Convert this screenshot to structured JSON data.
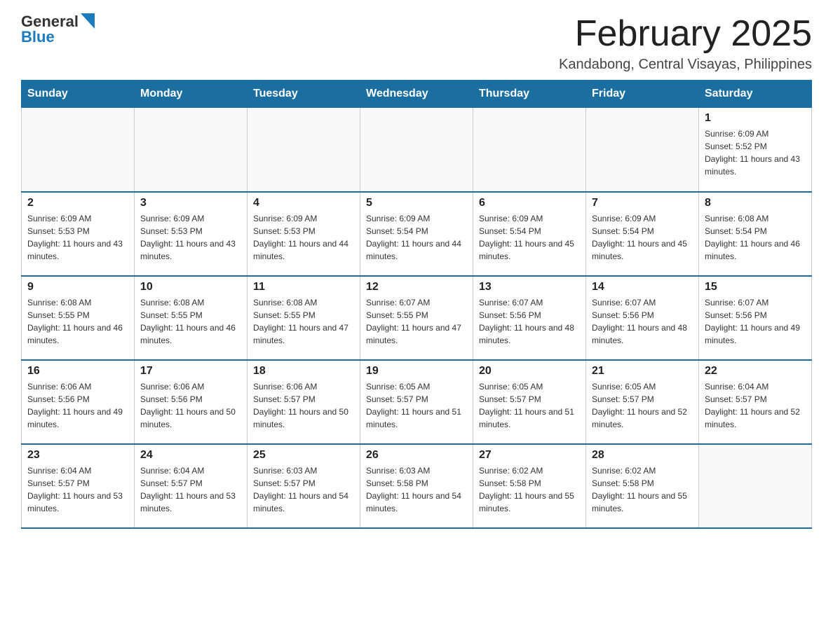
{
  "logo": {
    "text_general": "General",
    "text_blue": "Blue"
  },
  "title": "February 2025",
  "subtitle": "Kandabong, Central Visayas, Philippines",
  "weekdays": [
    "Sunday",
    "Monday",
    "Tuesday",
    "Wednesday",
    "Thursday",
    "Friday",
    "Saturday"
  ],
  "weeks": [
    [
      {
        "day": "",
        "sunrise": "",
        "sunset": "",
        "daylight": ""
      },
      {
        "day": "",
        "sunrise": "",
        "sunset": "",
        "daylight": ""
      },
      {
        "day": "",
        "sunrise": "",
        "sunset": "",
        "daylight": ""
      },
      {
        "day": "",
        "sunrise": "",
        "sunset": "",
        "daylight": ""
      },
      {
        "day": "",
        "sunrise": "",
        "sunset": "",
        "daylight": ""
      },
      {
        "day": "",
        "sunrise": "",
        "sunset": "",
        "daylight": ""
      },
      {
        "day": "1",
        "sunrise": "Sunrise: 6:09 AM",
        "sunset": "Sunset: 5:52 PM",
        "daylight": "Daylight: 11 hours and 43 minutes."
      }
    ],
    [
      {
        "day": "2",
        "sunrise": "Sunrise: 6:09 AM",
        "sunset": "Sunset: 5:53 PM",
        "daylight": "Daylight: 11 hours and 43 minutes."
      },
      {
        "day": "3",
        "sunrise": "Sunrise: 6:09 AM",
        "sunset": "Sunset: 5:53 PM",
        "daylight": "Daylight: 11 hours and 43 minutes."
      },
      {
        "day": "4",
        "sunrise": "Sunrise: 6:09 AM",
        "sunset": "Sunset: 5:53 PM",
        "daylight": "Daylight: 11 hours and 44 minutes."
      },
      {
        "day": "5",
        "sunrise": "Sunrise: 6:09 AM",
        "sunset": "Sunset: 5:54 PM",
        "daylight": "Daylight: 11 hours and 44 minutes."
      },
      {
        "day": "6",
        "sunrise": "Sunrise: 6:09 AM",
        "sunset": "Sunset: 5:54 PM",
        "daylight": "Daylight: 11 hours and 45 minutes."
      },
      {
        "day": "7",
        "sunrise": "Sunrise: 6:09 AM",
        "sunset": "Sunset: 5:54 PM",
        "daylight": "Daylight: 11 hours and 45 minutes."
      },
      {
        "day": "8",
        "sunrise": "Sunrise: 6:08 AM",
        "sunset": "Sunset: 5:54 PM",
        "daylight": "Daylight: 11 hours and 46 minutes."
      }
    ],
    [
      {
        "day": "9",
        "sunrise": "Sunrise: 6:08 AM",
        "sunset": "Sunset: 5:55 PM",
        "daylight": "Daylight: 11 hours and 46 minutes."
      },
      {
        "day": "10",
        "sunrise": "Sunrise: 6:08 AM",
        "sunset": "Sunset: 5:55 PM",
        "daylight": "Daylight: 11 hours and 46 minutes."
      },
      {
        "day": "11",
        "sunrise": "Sunrise: 6:08 AM",
        "sunset": "Sunset: 5:55 PM",
        "daylight": "Daylight: 11 hours and 47 minutes."
      },
      {
        "day": "12",
        "sunrise": "Sunrise: 6:07 AM",
        "sunset": "Sunset: 5:55 PM",
        "daylight": "Daylight: 11 hours and 47 minutes."
      },
      {
        "day": "13",
        "sunrise": "Sunrise: 6:07 AM",
        "sunset": "Sunset: 5:56 PM",
        "daylight": "Daylight: 11 hours and 48 minutes."
      },
      {
        "day": "14",
        "sunrise": "Sunrise: 6:07 AM",
        "sunset": "Sunset: 5:56 PM",
        "daylight": "Daylight: 11 hours and 48 minutes."
      },
      {
        "day": "15",
        "sunrise": "Sunrise: 6:07 AM",
        "sunset": "Sunset: 5:56 PM",
        "daylight": "Daylight: 11 hours and 49 minutes."
      }
    ],
    [
      {
        "day": "16",
        "sunrise": "Sunrise: 6:06 AM",
        "sunset": "Sunset: 5:56 PM",
        "daylight": "Daylight: 11 hours and 49 minutes."
      },
      {
        "day": "17",
        "sunrise": "Sunrise: 6:06 AM",
        "sunset": "Sunset: 5:56 PM",
        "daylight": "Daylight: 11 hours and 50 minutes."
      },
      {
        "day": "18",
        "sunrise": "Sunrise: 6:06 AM",
        "sunset": "Sunset: 5:57 PM",
        "daylight": "Daylight: 11 hours and 50 minutes."
      },
      {
        "day": "19",
        "sunrise": "Sunrise: 6:05 AM",
        "sunset": "Sunset: 5:57 PM",
        "daylight": "Daylight: 11 hours and 51 minutes."
      },
      {
        "day": "20",
        "sunrise": "Sunrise: 6:05 AM",
        "sunset": "Sunset: 5:57 PM",
        "daylight": "Daylight: 11 hours and 51 minutes."
      },
      {
        "day": "21",
        "sunrise": "Sunrise: 6:05 AM",
        "sunset": "Sunset: 5:57 PM",
        "daylight": "Daylight: 11 hours and 52 minutes."
      },
      {
        "day": "22",
        "sunrise": "Sunrise: 6:04 AM",
        "sunset": "Sunset: 5:57 PM",
        "daylight": "Daylight: 11 hours and 52 minutes."
      }
    ],
    [
      {
        "day": "23",
        "sunrise": "Sunrise: 6:04 AM",
        "sunset": "Sunset: 5:57 PM",
        "daylight": "Daylight: 11 hours and 53 minutes."
      },
      {
        "day": "24",
        "sunrise": "Sunrise: 6:04 AM",
        "sunset": "Sunset: 5:57 PM",
        "daylight": "Daylight: 11 hours and 53 minutes."
      },
      {
        "day": "25",
        "sunrise": "Sunrise: 6:03 AM",
        "sunset": "Sunset: 5:57 PM",
        "daylight": "Daylight: 11 hours and 54 minutes."
      },
      {
        "day": "26",
        "sunrise": "Sunrise: 6:03 AM",
        "sunset": "Sunset: 5:58 PM",
        "daylight": "Daylight: 11 hours and 54 minutes."
      },
      {
        "day": "27",
        "sunrise": "Sunrise: 6:02 AM",
        "sunset": "Sunset: 5:58 PM",
        "daylight": "Daylight: 11 hours and 55 minutes."
      },
      {
        "day": "28",
        "sunrise": "Sunrise: 6:02 AM",
        "sunset": "Sunset: 5:58 PM",
        "daylight": "Daylight: 11 hours and 55 minutes."
      },
      {
        "day": "",
        "sunrise": "",
        "sunset": "",
        "daylight": ""
      }
    ]
  ]
}
